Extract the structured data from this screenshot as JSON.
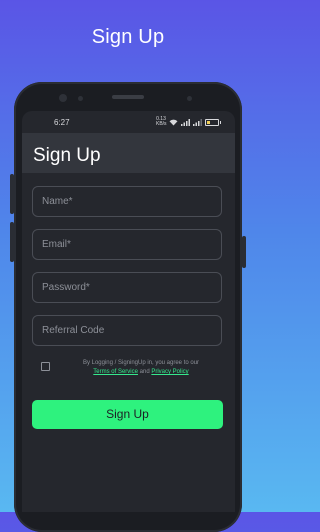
{
  "promo": {
    "title": "Sign Up"
  },
  "status_bar": {
    "time": "6:27",
    "net_speed": "0.13 KB/s",
    "battery_level": 0.3
  },
  "app_bar": {
    "title": "Sign Up"
  },
  "form": {
    "name": {
      "placeholder": "Name*",
      "value": ""
    },
    "email": {
      "placeholder": "Email*",
      "value": ""
    },
    "password": {
      "placeholder": "Password*",
      "value": ""
    },
    "referral": {
      "placeholder": "Referral Code",
      "value": ""
    }
  },
  "terms": {
    "prefix": "By Logging / SigningUp in, you agree to our",
    "terms_link": "Terms of Service",
    "and": "and",
    "privacy_link": "Privacy Policy"
  },
  "actions": {
    "signup_label": "Sign Up"
  },
  "colors": {
    "accent": "#2ef27e",
    "screen_bg": "#25272d",
    "app_bar_bg": "#33363d",
    "link": "#35e88c"
  },
  "icons": {
    "wifi": "wifi-icon",
    "signal": "signal-icon",
    "battery": "battery-icon"
  }
}
